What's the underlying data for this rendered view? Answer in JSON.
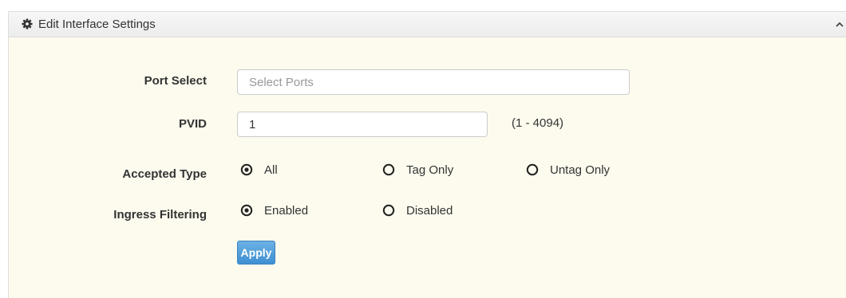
{
  "panel": {
    "title": "Edit Interface Settings",
    "header_icon": "gear-icon",
    "collapse_icon": "chevron-up-icon"
  },
  "form": {
    "port_select": {
      "label": "Port Select",
      "placeholder": "Select Ports",
      "value": ""
    },
    "pvid": {
      "label": "PVID",
      "value": "1",
      "range_hint": "(1 - 4094)"
    },
    "accepted_type": {
      "label": "Accepted Type",
      "options": [
        {
          "label": "All",
          "selected": true
        },
        {
          "label": "Tag Only",
          "selected": false
        },
        {
          "label": "Untag Only",
          "selected": false
        }
      ]
    },
    "ingress_filtering": {
      "label": "Ingress Filtering",
      "options": [
        {
          "label": "Enabled",
          "selected": true
        },
        {
          "label": "Disabled",
          "selected": false
        }
      ]
    },
    "apply_label": "Apply"
  },
  "colors": {
    "panel_bg": "#fcfbee",
    "header_bg": "#f0f0f0",
    "button_bg": "#4a98d8",
    "text": "#333333"
  }
}
